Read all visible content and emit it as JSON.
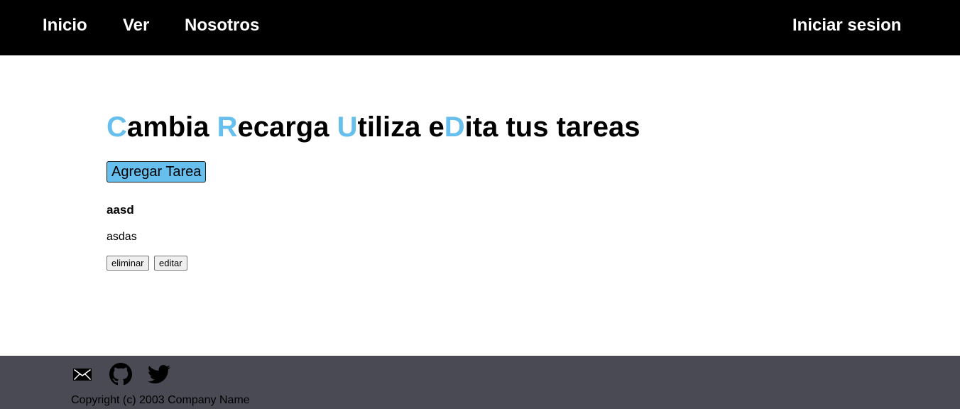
{
  "nav": {
    "home": "Inicio",
    "view": "Ver",
    "about": "Nosotros",
    "login": "Iniciar sesion"
  },
  "hero": {
    "parts": [
      {
        "accent": "C",
        "rest": "ambia "
      },
      {
        "accent": "R",
        "rest": "ecarga "
      },
      {
        "accent": "U",
        "rest": "tiliza "
      },
      {
        "prefix": "e",
        "accent": "D",
        "rest": "ita tus tareas"
      }
    ],
    "accent_color": "#66bfec"
  },
  "actions": {
    "add_task": "Agregar Tarea"
  },
  "tasks": [
    {
      "title": "aasd",
      "description": "asdas",
      "delete_label": "eliminar",
      "edit_label": "editar"
    }
  ],
  "footer": {
    "icons": [
      "mail-icon",
      "github-icon",
      "twitter-icon"
    ],
    "copyright": "Copyright (c) 2003 Company Name"
  },
  "colors": {
    "nav_background": "#000000",
    "footer_background": "#4a4a55",
    "accent": "#66bfec"
  }
}
